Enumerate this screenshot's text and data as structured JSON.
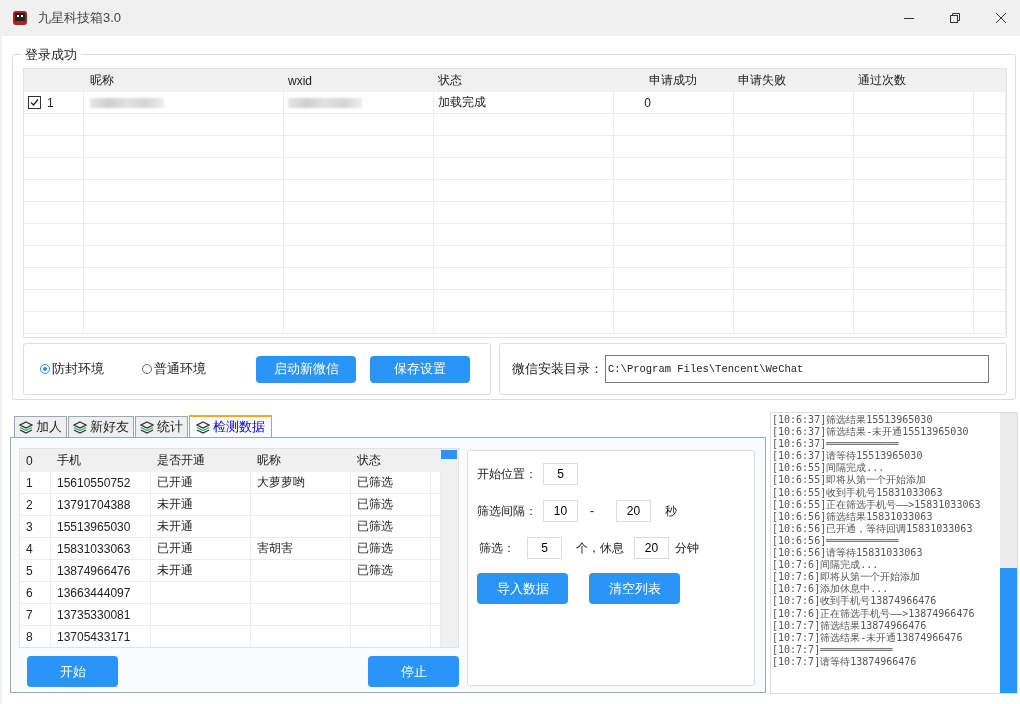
{
  "window": {
    "title": "九星科技箱3.0"
  },
  "login_group": {
    "title": "登录成功",
    "columns": [
      "",
      "昵称",
      "wxid",
      "状态",
      "申请成功",
      "申请失败",
      "通过次数"
    ],
    "rows": [
      {
        "checked": true,
        "index": "1",
        "status": "加载完成",
        "success": "0"
      }
    ]
  },
  "environment": {
    "options": [
      {
        "label": "防封环境",
        "selected": true
      },
      {
        "label": "普通环境",
        "selected": false
      }
    ],
    "buttons": [
      "启动新微信",
      "保存设置"
    ]
  },
  "install_dir": {
    "label": "微信安装目录：",
    "value": "C:\\Program Files\\Tencent\\WeChat"
  },
  "tabs": [
    {
      "label": "加人",
      "selected": false
    },
    {
      "label": "新好友",
      "selected": false
    },
    {
      "label": "统计",
      "selected": false
    },
    {
      "label": "检测数据",
      "selected": true
    }
  ],
  "detect_table": {
    "columns": [
      "0",
      "手机",
      "是否开通",
      "昵称",
      "状态"
    ],
    "rows": [
      [
        "1",
        "15610550752",
        "已开通",
        "大萝萝哟",
        "已筛选"
      ],
      [
        "2",
        "13791704388",
        "未开通",
        "",
        "已筛选"
      ],
      [
        "3",
        "15513965030",
        "未开通",
        "",
        "已筛选"
      ],
      [
        "4",
        "15831033063",
        "已开通",
        "害胡害",
        "已筛选"
      ],
      [
        "5",
        "13874966476",
        "未开通",
        "",
        "已筛选"
      ],
      [
        "6",
        "13663444097",
        "",
        "",
        ""
      ],
      [
        "7",
        "13735330081",
        "",
        "",
        ""
      ],
      [
        "8",
        "13705433171",
        "",
        "",
        ""
      ]
    ]
  },
  "detect_buttons": [
    "开始",
    "停止"
  ],
  "settings": {
    "start_label": "开始位置：",
    "start_value": "5",
    "interval_label": "筛选间隔：",
    "interval_min": "10",
    "interval_dash": "-",
    "interval_max": "20",
    "interval_unit": "秒",
    "batch_label": "筛选：",
    "batch_count": "5",
    "batch_mid": "个，休息",
    "batch_rest": "20",
    "batch_unit": "分钟",
    "buttons": [
      "导入数据",
      "清空列表"
    ]
  },
  "log": [
    "[10:6:37]筛选结果15513965030",
    "[10:6:37]筛选结果-未开通15513965030",
    "[10:6:37]════════════",
    "[10:6:37]请等待15513965030",
    "[10:6:55]间隔完成...",
    "[10:6:55]即将从第一个开始添加",
    "[10:6:55]收到手机号15831033063",
    "[10:6:55]正在筛选手机号——>15831033063",
    "[10:6:56]筛选结果15831033063",
    "[10:6:56]已开通，等待回调15831033063",
    "[10:6:56]════════════",
    "[10:6:56]请等待15831033063",
    "[10:7:6]间隔完成...",
    "[10:7:6]即将从第一个开始添加",
    "[10:7:6]添加休息中...",
    "[10:7:6]收到手机号13874966476",
    "[10:7:6]正在筛选手机号——>13874966476",
    "[10:7:7]筛选结果13874966476",
    "[10:7:7]筛选结果-未开通13874966476",
    "[10:7:7]════════════",
    "[10:7:7]请等待13874966476"
  ]
}
